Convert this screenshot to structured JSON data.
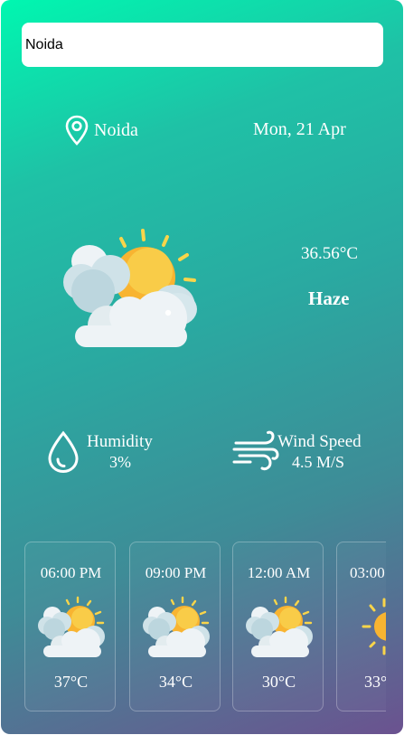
{
  "search": {
    "value": "Noida",
    "placeholder": ""
  },
  "location": {
    "name": "Noida",
    "icon": "map-pin-icon"
  },
  "date": "Mon, 21 Apr",
  "current": {
    "temperature": "36.56°C",
    "description": "Haze",
    "icon": "partly-cloudy-icon"
  },
  "humidity": {
    "label": "Humidity",
    "value": "3%",
    "icon": "water-drop-icon"
  },
  "wind": {
    "label": "Wind Speed",
    "value": "4.5 M/S",
    "icon": "wind-icon"
  },
  "forecast": [
    {
      "time": "06:00 PM",
      "temp": "37°C",
      "icon": "partly-cloudy-icon"
    },
    {
      "time": "09:00 PM",
      "temp": "34°C",
      "icon": "partly-cloudy-icon"
    },
    {
      "time": "12:00 AM",
      "temp": "30°C",
      "icon": "partly-cloudy-icon"
    },
    {
      "time": "03:00",
      "temp": "33°",
      "icon": "sun-icon"
    }
  ],
  "colors": {
    "gradient_top": "#00f7b0",
    "gradient_bottom": "#6b5290",
    "sun": "#f8b431",
    "cloud": "#eef3f6"
  }
}
